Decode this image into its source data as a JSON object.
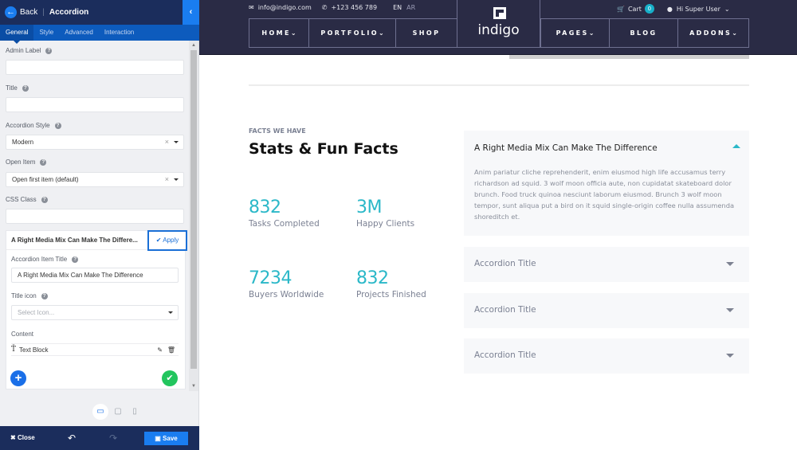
{
  "editor": {
    "header": {
      "back_label": "Back",
      "title": "Accordion",
      "collapse_icon": "chevron-left-icon"
    },
    "tabs": [
      {
        "label": "General",
        "active": true
      },
      {
        "label": "Style",
        "active": false
      },
      {
        "label": "Advanced",
        "active": false
      },
      {
        "label": "Interaction",
        "active": false
      }
    ],
    "fields": {
      "admin_label": {
        "label": "Admin Label",
        "value": ""
      },
      "title": {
        "label": "Title",
        "value": ""
      },
      "accordion_style": {
        "label": "Accordion Style",
        "value": "Modern"
      },
      "open_item": {
        "label": "Open Item",
        "value": "Open first item (default)"
      },
      "css_class": {
        "label": "CSS Class",
        "value": ""
      }
    },
    "item": {
      "header_title": "A Right Media Mix Can Make The Differe...",
      "apply_label": "Apply",
      "item_title_label": "Accordion Item Title",
      "item_title_value": "A Right Media Mix Can Make The Difference",
      "title_icon_label": "Title icon",
      "title_icon_placeholder": "Select Icon...",
      "content_label": "Content",
      "content_block": "Text Block"
    },
    "devices": [
      "desktop",
      "tablet",
      "mobile"
    ],
    "active_device": "desktop",
    "footer": {
      "close_label": "Close",
      "save_label": "Save"
    }
  },
  "site": {
    "topbar": {
      "email": "info@indigo.com",
      "phone": "+123 456 789",
      "lang_en": "EN",
      "lang_ar": "AR",
      "cart_label": "Cart",
      "cart_count": "0",
      "user_label": "Hi Super User"
    },
    "logo_text": "indigo",
    "nav_left": [
      {
        "label": "HOME",
        "dropdown": true
      },
      {
        "label": "PORTFOLIO",
        "dropdown": true
      },
      {
        "label": "SHOP",
        "dropdown": false
      }
    ],
    "nav_right": [
      {
        "label": "PAGES",
        "dropdown": true
      },
      {
        "label": "BLOG",
        "dropdown": false
      },
      {
        "label": "ADDONS",
        "dropdown": true
      }
    ],
    "section": {
      "eyebrow": "FACTS WE HAVE",
      "title": "Stats & Fun Facts",
      "stats": [
        {
          "number": "832",
          "label": "Tasks Completed"
        },
        {
          "number": "3M",
          "label": "Happy Clients"
        },
        {
          "number": "7234",
          "label": "Buyers Worldwide"
        },
        {
          "number": "832",
          "label": "Projects Finished"
        }
      ]
    },
    "accordion": [
      {
        "title": "A Right Media Mix Can Make The Difference",
        "open": true,
        "body": "Anim pariatur cliche reprehenderit, enim eiusmod high life accusamus terry richardson ad squid. 3 wolf moon officia aute, non cupidatat skateboard dolor brunch. Food truck quinoa nesciunt laborum eiusmod. Brunch 3 wolf moon tempor, sunt aliqua put a bird on it squid single-origin coffee nulla assumenda shoreditch et."
      },
      {
        "title": "Accordion Title",
        "open": false
      },
      {
        "title": "Accordion Title",
        "open": false
      },
      {
        "title": "Accordion Title",
        "open": false
      }
    ],
    "colors": {
      "header_bg": "#2a2b45",
      "accent": "#2bb8c8",
      "editor_blue": "#1a7df0",
      "editor_navy": "#1b2d5c"
    }
  }
}
